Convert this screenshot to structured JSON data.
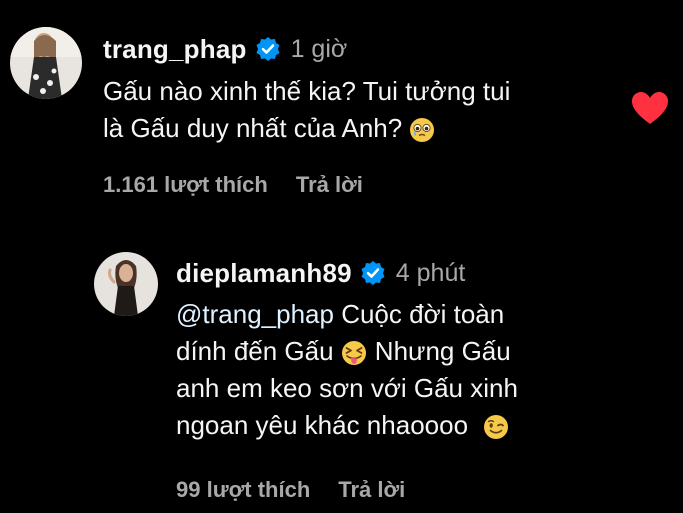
{
  "colors": {
    "background": "#000000",
    "text_primary": "#f5f5f5",
    "text_secondary": "#a8a8a8",
    "verified_blue": "#0095f6",
    "heart_red": "#ff3040",
    "mention": "#e0f1ff"
  },
  "comment": {
    "avatar_icon": "avatar-trang-phap",
    "username": "trang_phap",
    "verified_icon": "verified-badge-icon",
    "time": "1 giờ",
    "lines": [
      "Gấu nào xinh thế kia? Tui tưởng tui",
      "là Gấu duy nhất của Anh?"
    ],
    "emoji_icon": "flushed-crying-face",
    "likes": "1.161 lượt thích",
    "reply_label": "Trả lời",
    "liked_icon": "heart-filled-icon"
  },
  "reply": {
    "avatar_icon": "avatar-dieplamanh89",
    "username": "dieplamanh89",
    "verified_icon": "verified-badge-icon",
    "time": "4 phút",
    "mention": "@trang_phap",
    "line1_rest": " Cuộc đời toàn",
    "line2": "dính đến Gấu",
    "line2_after_emoji": " Nhưng Gấu",
    "line3": "anh em keo sơn với Gấu xinh",
    "line4": "ngoan yêu khác nhaoooo",
    "emoji1_icon": "squinting-tongue-face",
    "emoji2_icon": "winking-face",
    "likes": "99 lượt thích",
    "reply_label": "Trả lời"
  }
}
